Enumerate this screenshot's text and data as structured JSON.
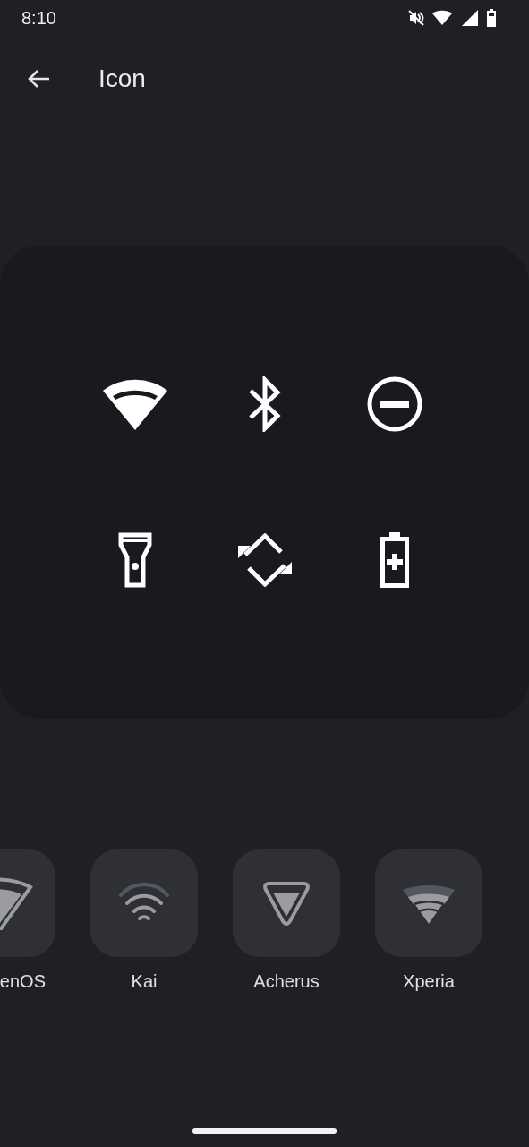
{
  "status_bar": {
    "time": "8:10"
  },
  "app_bar": {
    "title": "Icon"
  },
  "icon_styles": [
    {
      "label": "enOS",
      "kind": "wedge",
      "clipped": true
    },
    {
      "label": "Kai",
      "kind": "arcs",
      "clipped": false
    },
    {
      "label": "Acherus",
      "kind": "triangle",
      "clipped": false
    },
    {
      "label": "Xperia",
      "kind": "fan",
      "clipped": false
    }
  ]
}
